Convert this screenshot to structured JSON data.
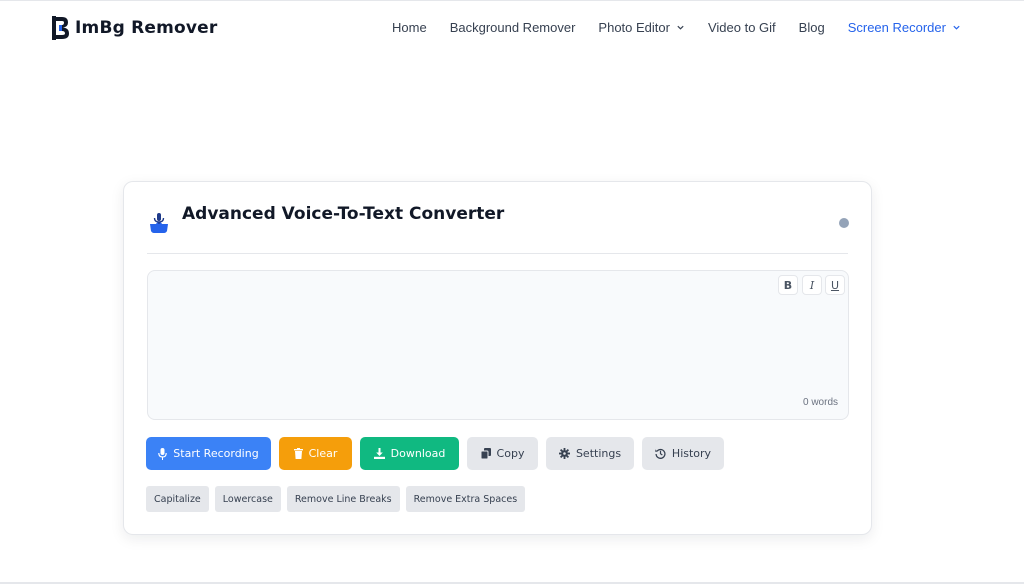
{
  "brand": {
    "name": "ImBg Remover"
  },
  "nav": [
    {
      "label": "Home",
      "dropdown": false,
      "active": false
    },
    {
      "label": "Background Remover",
      "dropdown": false,
      "active": false
    },
    {
      "label": "Photo Editor",
      "dropdown": true,
      "active": false
    },
    {
      "label": "Video to Gif",
      "dropdown": false,
      "active": false
    },
    {
      "label": "Blog",
      "dropdown": false,
      "active": false
    },
    {
      "label": "Screen Recorder",
      "dropdown": true,
      "active": true
    }
  ],
  "card": {
    "title": "Advanced Voice-To-Text Converter",
    "editor": {
      "format_buttons": [
        "B",
        "I",
        "U"
      ],
      "text": "",
      "word_count": "0 words"
    },
    "actions": {
      "start_recording": "Start Recording",
      "clear": "Clear",
      "download": "Download",
      "copy": "Copy",
      "settings": "Settings",
      "history": "History"
    },
    "transforms": [
      "Capitalize",
      "Lowercase",
      "Remove Line Breaks",
      "Remove Extra Spaces"
    ]
  },
  "colors": {
    "accent": "#2563eb",
    "record": "#3b82f6",
    "clear": "#f59e0b",
    "download": "#10b981",
    "neutral_button": "#e5e7eb",
    "status_dot": "#94a3b8"
  },
  "icons": {
    "head": "voice-input-icon",
    "start_recording": "microphone-icon",
    "clear": "trash-icon",
    "download": "download-icon",
    "copy": "copy-icon",
    "settings": "gear-icon",
    "history": "history-icon"
  }
}
